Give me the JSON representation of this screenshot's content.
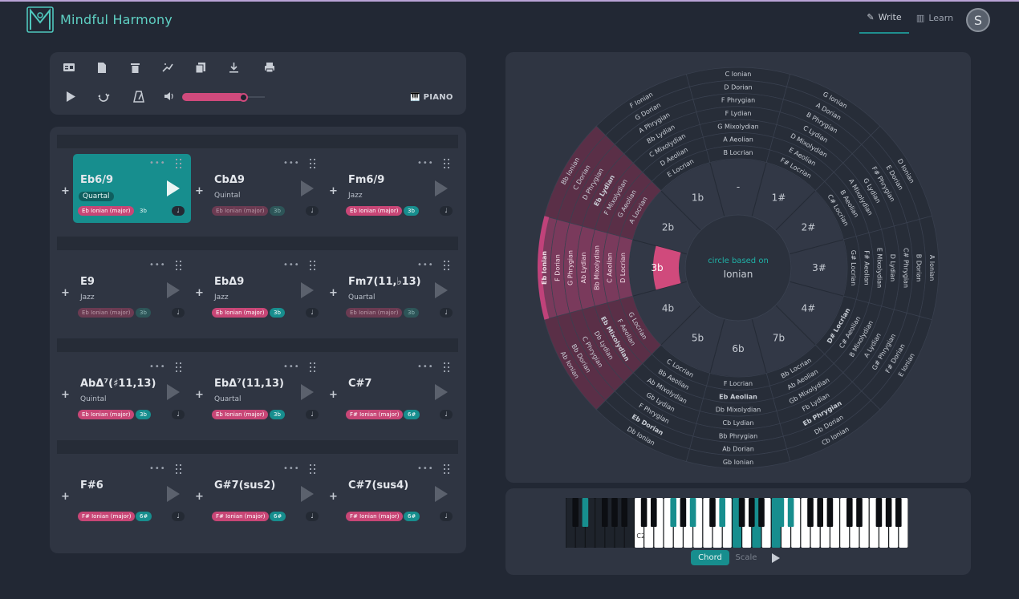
{
  "app": {
    "title": "Mindful Harmony"
  },
  "nav": {
    "write": "Write",
    "learn": "Learn",
    "avatar_letter": "S"
  },
  "toolbar": {
    "icons": [
      "card-icon",
      "new-file-icon",
      "trash-icon",
      "wand-icon",
      "copy-icon",
      "download-icon",
      "print-icon"
    ],
    "transport": [
      "play-icon",
      "loop-icon",
      "metronome-icon",
      "volume-icon"
    ],
    "volume_percent": 75,
    "instrument": "PIANO"
  },
  "rows": [
    {
      "cards": [
        {
          "name": "Eb6/9",
          "type": "Quartal",
          "scale": "Eb Ionian (major)",
          "key": "3b",
          "note": "𝅗𝅥",
          "selected": true
        },
        {
          "name": "CbΔ9",
          "type": "Quintal",
          "scale": "Eb Ionian (major)",
          "key": "3b",
          "note": "𝅗𝅥",
          "dim": true
        },
        {
          "name": "Fm6/9",
          "type": "Jazz",
          "scale": "Eb Ionian (major)",
          "key": "3b",
          "note": "𝅗𝅥"
        }
      ]
    },
    {
      "cards": [
        {
          "name": "E9",
          "type": "Jazz",
          "scale": "Eb Ionian (major)",
          "key": "3b",
          "note": "𝅗𝅥",
          "dim": true
        },
        {
          "name": "EbΔ9",
          "type": "Jazz",
          "scale": "Eb Ionian (major)",
          "key": "3b",
          "note": "𝅗𝅥"
        },
        {
          "name": "Fm7(11,♭13)",
          "type": "Quartal",
          "scale": "Eb Ionian (major)",
          "key": "3b",
          "note": "𝅗𝅥",
          "dim": true
        }
      ]
    },
    {
      "cards": [
        {
          "name": "AbΔ⁷(♯11,13)",
          "type": "Quintal",
          "scale": "Eb Ionian (major)",
          "key": "3b",
          "note": "𝅗𝅥"
        },
        {
          "name": "EbΔ⁷(11,13)",
          "type": "Quartal",
          "scale": "Eb Ionian (major)",
          "key": "3b",
          "note": "𝅗𝅥"
        },
        {
          "name": "C#7",
          "type": "",
          "scale": "F# Ionian (major)",
          "key": "6#",
          "note": "𝅗𝅥"
        }
      ]
    },
    {
      "cards": [
        {
          "name": "F#6",
          "type": "",
          "scale": "F# Ionian (major)",
          "key": "6#",
          "note": "𝅗𝅥"
        },
        {
          "name": "G#7(sus2)",
          "type": "",
          "scale": "F# Ionian (major)",
          "key": "6#",
          "note": "𝅗𝅥"
        },
        {
          "name": "C#7(sus4)",
          "type": "",
          "scale": "F# Ionian (major)",
          "key": "6#",
          "note": "𝅗𝅥"
        }
      ]
    }
  ],
  "circle": {
    "center_line1": "circle based on",
    "center_line2": "Ionian",
    "keys": [
      "-",
      "1#",
      "2#",
      "3#",
      "4#",
      "7b",
      "6b",
      "5b",
      "4b",
      "3b",
      "2b",
      "1b"
    ],
    "selected_key_index": 9,
    "highlight_sector_index": 9,
    "modes": [
      [
        "C Ionian",
        "D Dorian",
        "F Phrygian",
        "F Lydian",
        "G Mixolydian",
        "A Aeolian",
        "B Locrian"
      ],
      [
        "G Ionian",
        "A Dorian",
        "B Phrygian",
        "C Lydian",
        "D Mixolydian",
        "E Aeolian",
        "F# Locrian"
      ],
      [
        "D Ionian",
        "E Dorian",
        "F# Phrygian",
        "G Lydian",
        "A Mixolydian",
        "B Aeolian",
        "C# Locrian"
      ],
      [
        "A Ionian",
        "B Dorian",
        "C# Phrygian",
        "D Lydian",
        "E Mixolydian",
        "F# Aeolian",
        "G# Locrian"
      ],
      [
        "E Ionian",
        "F# Dorian",
        "G# Phrygian",
        "A Lydian",
        "B Mixolydian",
        "C# Aeolian",
        "D# Locrian"
      ],
      [
        "Cb Ionian",
        "Db Dorian",
        "Eb Phrygian",
        "Fb Lydian",
        "Gb Mixolydian",
        "Ab Aeolian",
        "Bb Locrian"
      ],
      [
        "Gb Ionian",
        "Ab Dorian",
        "Bb Phrygian",
        "Cb Lydian",
        "Db Mixolydian",
        "Eb Aeolian",
        "F Locrian"
      ],
      [
        "Db Ionian",
        "Eb Dorian",
        "F Phrygian",
        "Gb Lydian",
        "Ab Mixolydian",
        "Bb Aeolian",
        "C Locrian"
      ],
      [
        "Ab Ionian",
        "Bb Dorian",
        "C Phrygian",
        "Db Lydian",
        "Eb Mixolydian",
        "F Aeolian",
        "G Locrian"
      ],
      [
        "Eb Ionian",
        "F Dorian",
        "G Phrygian",
        "Ab Lydian",
        "Bb Mixolydian",
        "C Aeolian",
        "D Locrian"
      ],
      [
        "Bb Ionian",
        "C Dorian",
        "D Phrygian",
        "Eb Lydian",
        "F Mixolydian",
        "G Aeolian",
        "A Locrian"
      ],
      [
        "F Ionian",
        "G Dorian",
        "A Phrygian",
        "Bb Lydian",
        "C Mixolydian",
        "D Aeolian",
        "E Locrian"
      ]
    ],
    "bold_labels": [
      "Eb Ionian",
      "Eb Lydian",
      "Eb Mixolydian",
      "Eb Aeolian",
      "Eb Phrygian",
      "Eb Dorian",
      "D# Locrian"
    ],
    "colors": {
      "accent": "#d04a7c",
      "sector": "#7a3a5c",
      "teal": "#178e8e"
    }
  },
  "piano": {
    "octave_label": "C2",
    "highlight_white": [
      17,
      19,
      21
    ],
    "highlight_black": [
      1,
      7,
      9,
      11,
      15,
      16
    ],
    "chord_button": "Chord",
    "scale_button": "Scale"
  }
}
